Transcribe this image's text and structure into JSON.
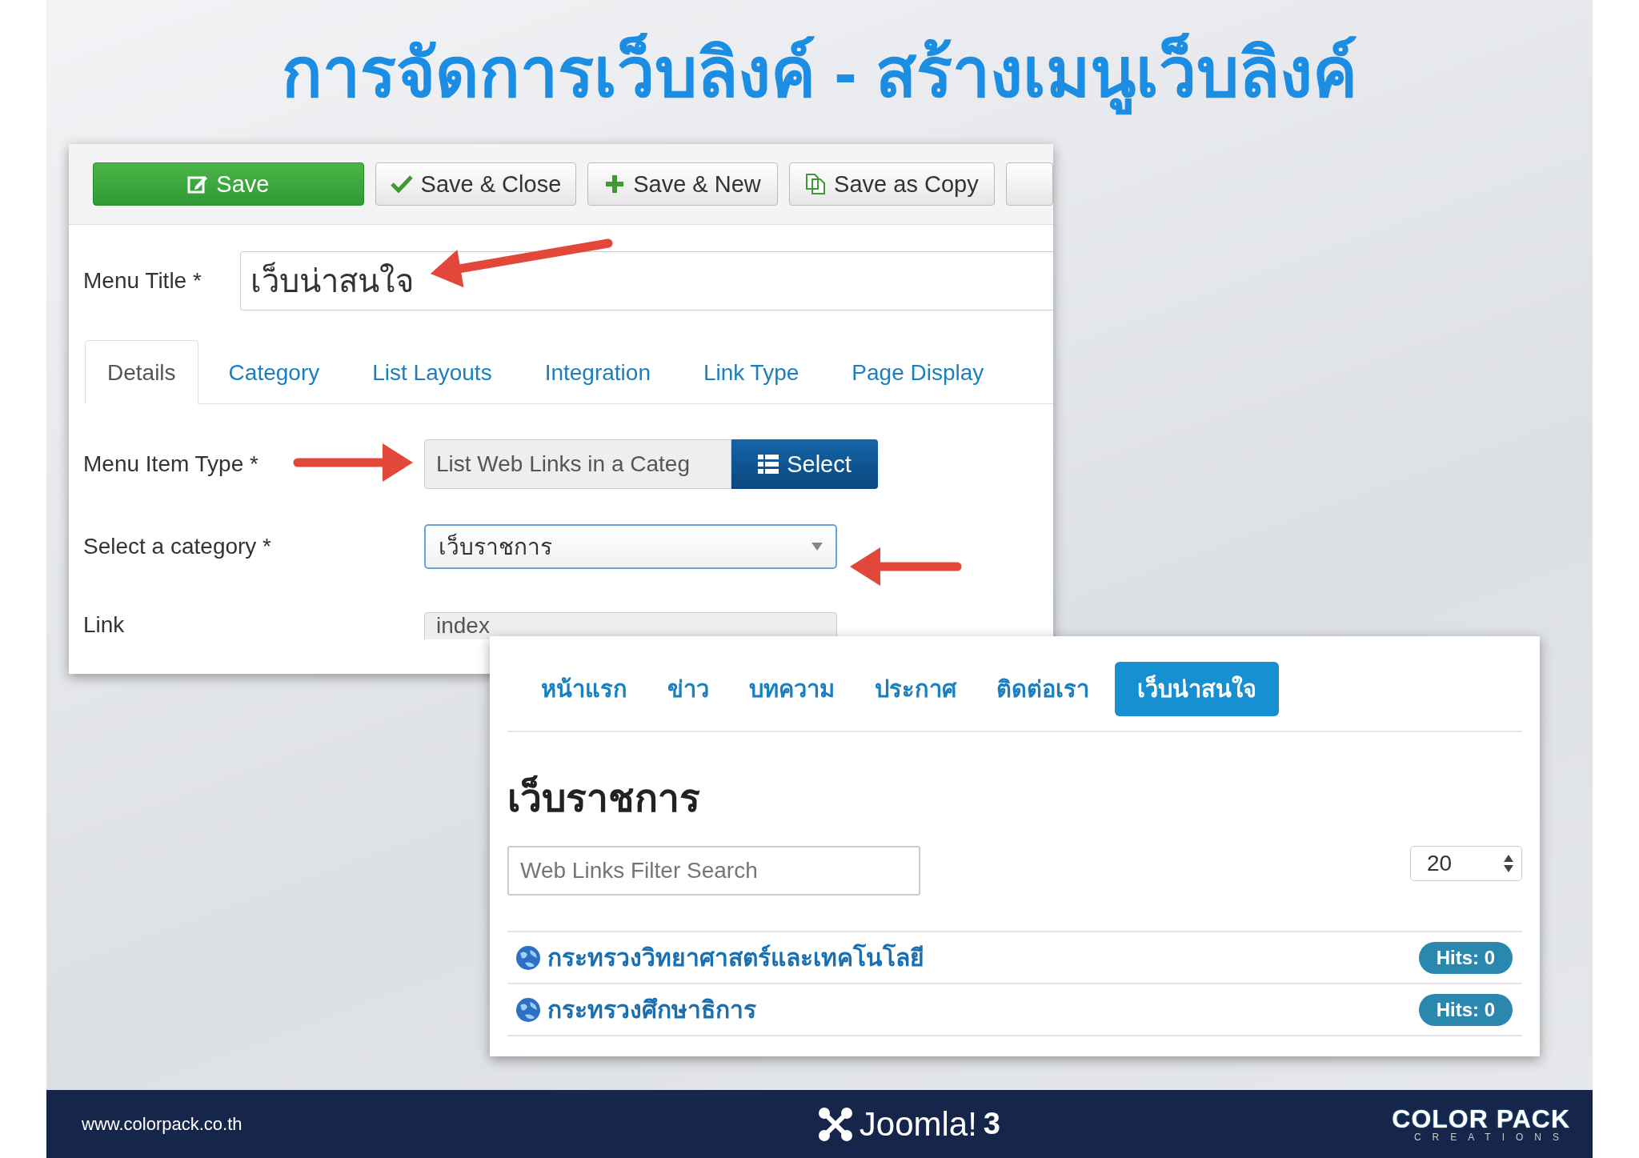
{
  "slide": {
    "title": "การจัดการเว็บลิงค์ - สร้างเมนูเว็บลิงค์"
  },
  "editor": {
    "toolbar": [
      {
        "kind": "save",
        "label": "Save"
      },
      {
        "kind": "close",
        "label": "Save & Close"
      },
      {
        "kind": "new",
        "label": "Save & New"
      },
      {
        "kind": "copy",
        "label": "Save as Copy"
      },
      {
        "kind": "partial"
      }
    ],
    "menu_title": {
      "label": "Menu Title *",
      "value": "เว็บน่าสนใจ"
    },
    "tabs": [
      {
        "label": "Details",
        "selected": true
      },
      {
        "label": "Category",
        "selected": false
      },
      {
        "label": "List Layouts",
        "selected": false
      },
      {
        "label": "Integration",
        "selected": false
      },
      {
        "label": "Link Type",
        "selected": false
      },
      {
        "label": "Page Display",
        "selected": false
      }
    ],
    "menu_item_type": {
      "label": "Menu Item Type *",
      "value": "List Web Links in a Categ",
      "button": "Select"
    },
    "category": {
      "label": "Select a category *",
      "value": "เว็บราชการ"
    },
    "link": {
      "label": "Link",
      "value": "index"
    }
  },
  "site": {
    "nav": [
      {
        "label": "หน้าแรก",
        "selected": false
      },
      {
        "label": "ข่าว",
        "selected": false
      },
      {
        "label": "บทความ",
        "selected": false
      },
      {
        "label": "ประกาศ",
        "selected": false
      },
      {
        "label": "ติดต่อเรา",
        "selected": false
      },
      {
        "label": "เว็บน่าสนใจ",
        "selected": true
      }
    ],
    "heading": "เว็บราชการ",
    "search": {
      "placeholder": "Web Links Filter Search"
    },
    "limit": "20",
    "links": [
      {
        "title": "กระทรวงวิทยาศาสตร์และเทคโนโลยี",
        "hits": "Hits: 0"
      },
      {
        "title": "กระทรวงศึกษาธิการ",
        "hits": "Hits: 0"
      }
    ]
  },
  "footer": {
    "url": "www.colorpack.co.th",
    "product": "Joomla!",
    "version": "3",
    "brand": "COLOR PACK",
    "brand_sub": "CREATIONS"
  }
}
